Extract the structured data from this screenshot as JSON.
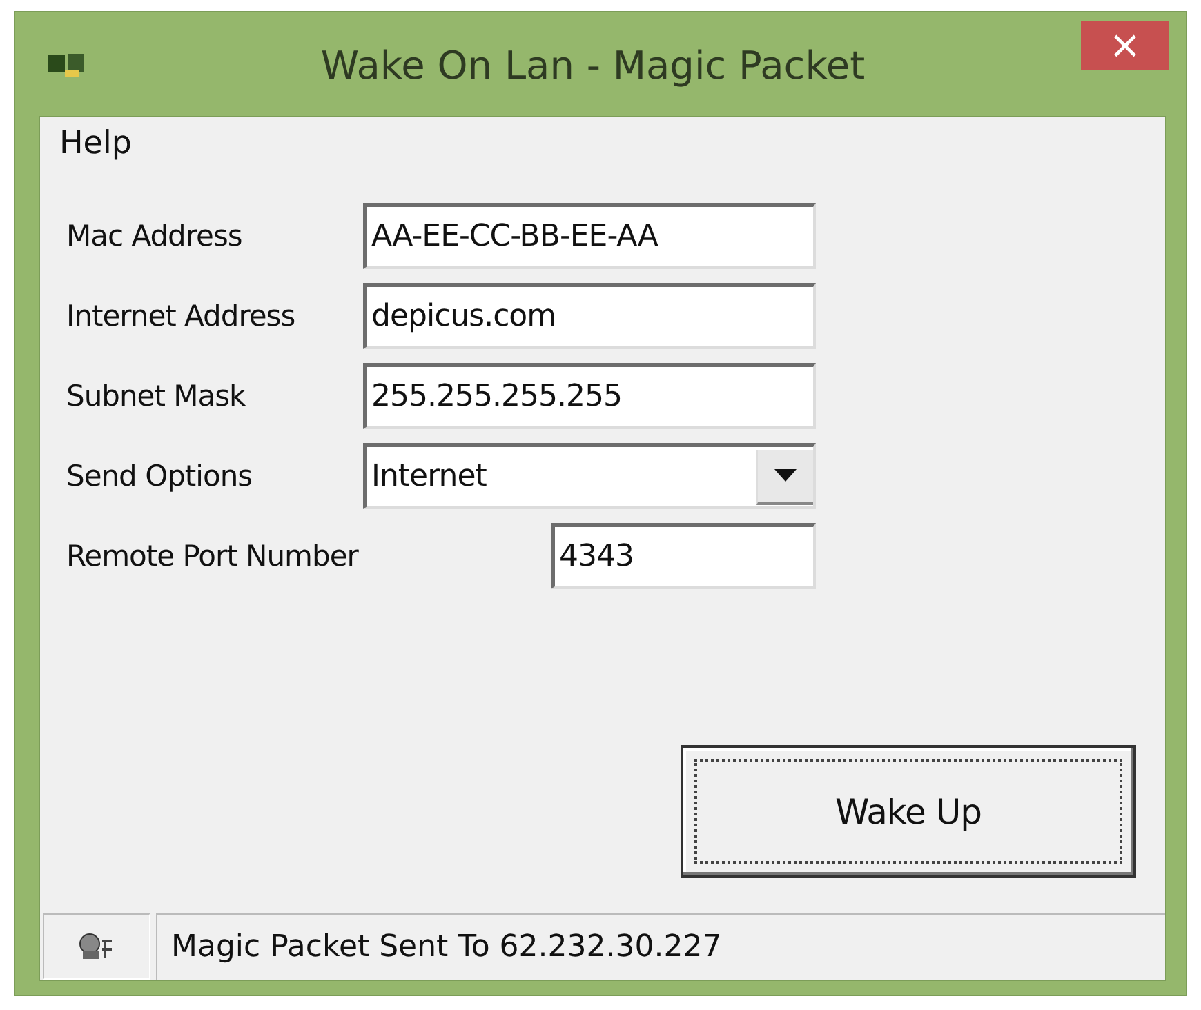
{
  "window": {
    "title": "Wake On Lan - Magic Packet",
    "close": "×"
  },
  "menu": [
    {
      "label": "Help"
    }
  ],
  "fields": [
    {
      "kind": "text",
      "label": "Mac Address",
      "value": "AA-EE-CC-BB-EE-AA"
    },
    {
      "kind": "text",
      "label": "Internet Address",
      "value": "depicus.com"
    },
    {
      "kind": "text",
      "label": "Subnet Mask",
      "value": "255.255.255.255"
    },
    {
      "kind": "select",
      "label": "Send Options",
      "value": "Internet"
    },
    {
      "kind": "short",
      "label": "Remote Port Number",
      "value": "4343"
    }
  ],
  "button": {
    "label": "Wake Up",
    "focused": true
  },
  "status_bar": {
    "text": "Magic Packet Sent To 62.232.30.227"
  }
}
